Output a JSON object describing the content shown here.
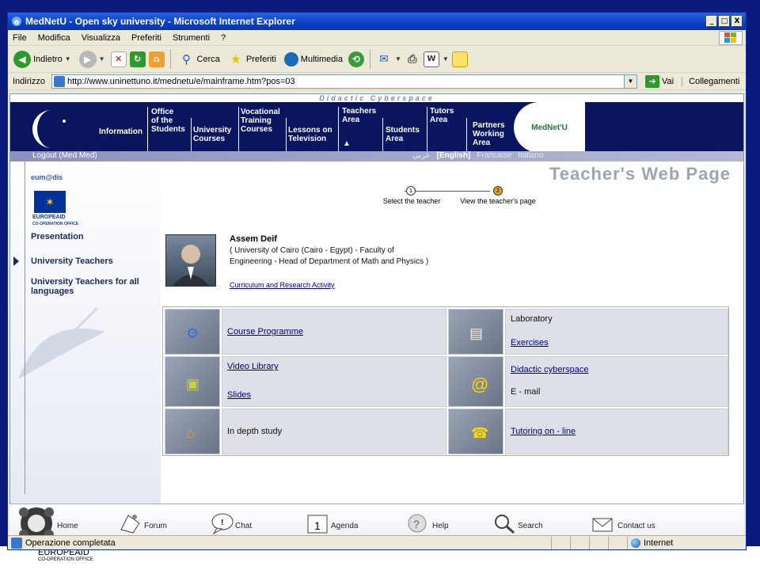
{
  "window": {
    "title": "MedNetU - Open sky university - Microsoft Internet Explorer",
    "btn_min": "_",
    "btn_max": "□",
    "btn_close": "X"
  },
  "menu": [
    {
      "label": "File"
    },
    {
      "label": "Modifica"
    },
    {
      "label": "Visualizza"
    },
    {
      "label": "Preferiti"
    },
    {
      "label": "Strumenti"
    },
    {
      "label": "?"
    }
  ],
  "toolbar": {
    "back": "Indietro",
    "search": "Cerca",
    "favorites": "Preferiti",
    "media": "Multimedia"
  },
  "address": {
    "label": "Indirizzo",
    "url": "http://www.uninettuno.it/mednetu/e/mainframe.htm?pos=03",
    "go": "Vai",
    "links": "Collegamenti"
  },
  "site": {
    "header": "Didactic Cyberspace",
    "logo": "MedNet'U",
    "nav": [
      {
        "label": "Information"
      },
      {
        "label": "Office\nof the\nStudents"
      },
      {
        "label": "University\nCourses"
      },
      {
        "label": "Vocational\nTraining\nCourses"
      },
      {
        "label": "Lessons on\nTelevision"
      },
      {
        "label": "Teachers\nArea"
      },
      {
        "label": "Students\nArea"
      },
      {
        "label": "Tutors\nArea"
      },
      {
        "label": "Partners\nWorking\nArea"
      }
    ],
    "logout": "Logout (Med Med)",
    "languages": {
      "arabic": "عربي",
      "english": "[English]",
      "french": "Francaise",
      "italian": "Italiano"
    },
    "page_title": "Teacher's Web Page",
    "sidebar": {
      "eumedis": "eum@dis",
      "europeaid": "EUROPEAID",
      "europeaid_sub": "CO-OPERATION OFFICE",
      "links": [
        {
          "label": "Presentation"
        },
        {
          "label": "University Teachers"
        },
        {
          "label": "University Teachers for all languages"
        }
      ]
    },
    "steps": [
      {
        "num": "1",
        "label": "Select the teacher"
      },
      {
        "num": "2",
        "label": "View the teacher's page"
      }
    ],
    "profile": {
      "name": "Assem Deif",
      "description": "( University of Cairo (Cairo - Egypt) - Faculty of Engineering - Head of Department of Math and Physics )",
      "link": "Curriculum and Research Activity"
    },
    "grid": {
      "course_programme": "Course Programme",
      "laboratory": "Laboratory",
      "exercises": "Exercises",
      "video_library": "Video Library",
      "slides": "Slides",
      "didactic_cyberspace": "Didactic cyberspace",
      "email": "E - mail",
      "in_depth": "In depth study",
      "tutoring": "Tutoring on - line"
    },
    "bottom_nav": [
      {
        "label": "Home"
      },
      {
        "label": "Forum"
      },
      {
        "label": "Chat"
      },
      {
        "label": "Agenda"
      },
      {
        "label": "Help"
      },
      {
        "label": "Search"
      },
      {
        "label": "Contact us"
      }
    ]
  },
  "status": {
    "text": "Operazione completata",
    "zone": "Internet"
  },
  "slide_footer": {
    "europeaid": "EUROPEAID",
    "sub": "CO-OPERATION OFFICE"
  }
}
